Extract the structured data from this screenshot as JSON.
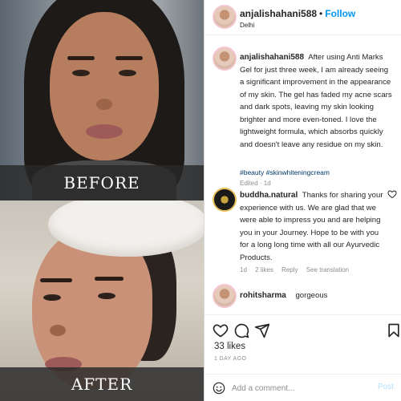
{
  "media": {
    "before_label": "BEFORE",
    "after_label": "AFTER"
  },
  "header": {
    "username": "anjalishahani588",
    "separator": "•",
    "follow_label": "Follow",
    "location": "Delhi"
  },
  "caption": {
    "username": "anjalishahani588",
    "text": "After using Anti Marks Gel for just three week, I am already seeing a significant improvement in the appearance of my skin. The gel has faded my acne scars and dark spots, leaving my skin looking brighter and more even-toned. I love the lightweight formula, which absorbs quickly and doesn't leave any residue on my skin.",
    "hashtags": "#beauty #skinwhiteningcream",
    "meta": "Edited · 1d"
  },
  "reply": {
    "username": "buddha.natural",
    "text": "Thanks for sharing your experience with us. We are glad that we were able to impress you and are helping you in your Journey. Hope to be with you for a long long time with all our Ayurvedic Products.",
    "time": "1d",
    "likes": "2 likes",
    "reply_label": "Reply",
    "translation_label": "See translation"
  },
  "comment3": {
    "username": "rohitsharma",
    "text": "gorgeous"
  },
  "likes_count": "33 likes",
  "time_ago": "1 DAY AGO",
  "add_comment": {
    "placeholder": "Add a comment...",
    "post_label": "Post"
  },
  "colors": {
    "accent": "#0095f6",
    "post_disabled": "#b2dffc",
    "hashtag": "#00376b",
    "muted": "#8e8e8e"
  },
  "icons": [
    "heart-icon",
    "comment-icon",
    "share-icon",
    "bookmark-icon",
    "emoji-icon"
  ]
}
